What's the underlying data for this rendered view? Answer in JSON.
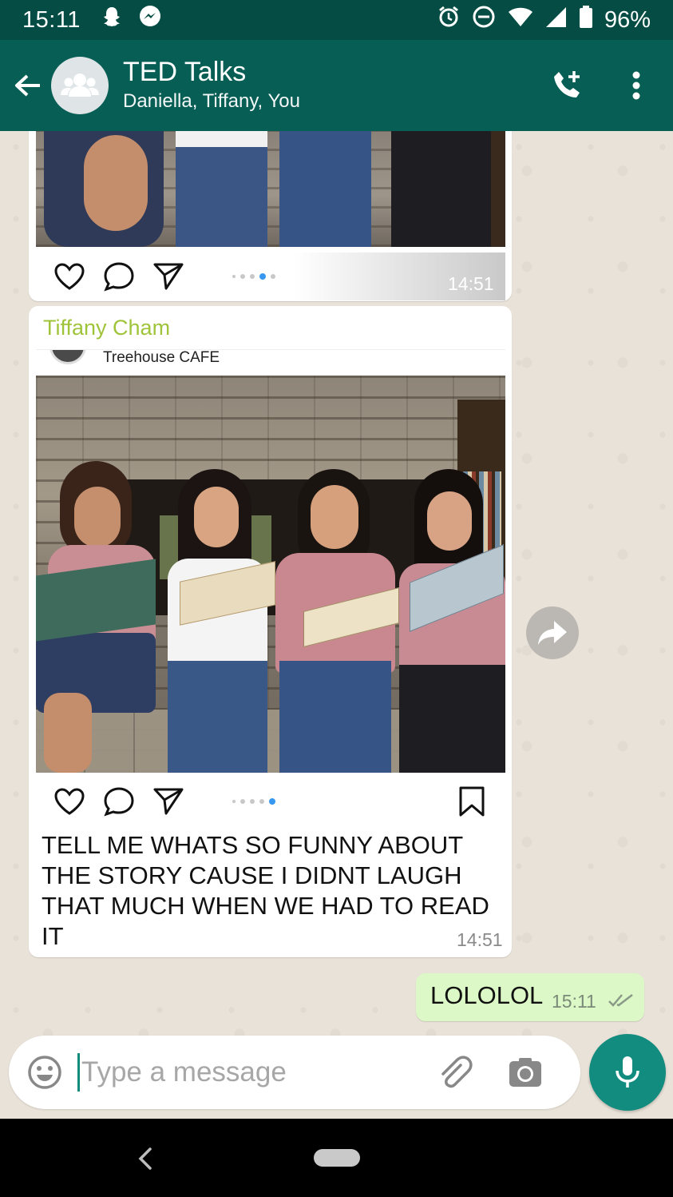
{
  "status_bar": {
    "time": "15:11",
    "battery": "96%",
    "icons": [
      "snapchat-icon",
      "messenger-icon",
      "alarm-icon",
      "do-not-disturb-icon",
      "wifi-icon",
      "signal-icon",
      "battery-icon"
    ]
  },
  "header": {
    "title": "TED Talks",
    "members": "Daniella, Tiffany, You",
    "colors": {
      "status_bar": "#054d44",
      "toolbar": "#075e54"
    }
  },
  "messages": {
    "first": {
      "time": "14:51"
    },
    "second": {
      "sender": "Tiffany Cham",
      "post_location": "Treehouse CAFE",
      "text": "TELL ME WHATS SO FUNNY ABOUT THE STORY CAUSE I DIDNT LAUGH THAT MUCH WHEN WE HAD TO READ IT",
      "time": "14:51"
    },
    "outgoing": {
      "text": "LOLOLOL",
      "time": "15:11"
    }
  },
  "composer": {
    "placeholder": "Type a message",
    "value": ""
  },
  "colors": {
    "accent": "#128c7e",
    "sender_name": "#9fc43a",
    "outgoing_bubble": "#dcf8c6"
  }
}
